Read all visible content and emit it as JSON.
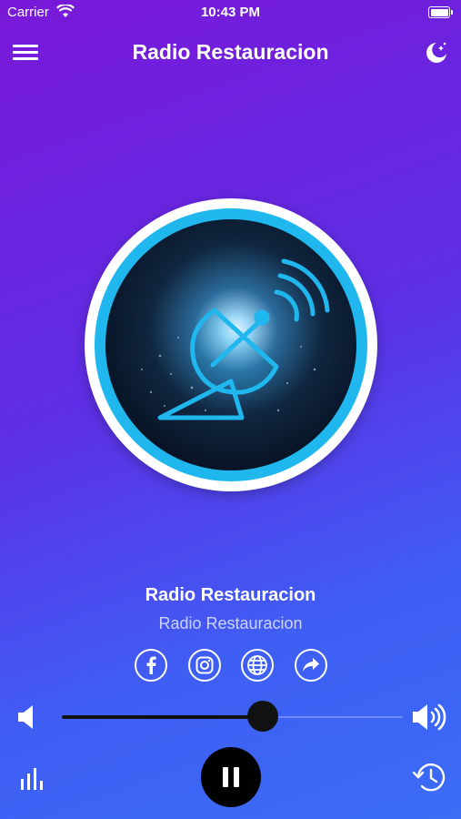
{
  "status_bar": {
    "carrier": "Carrier",
    "time": "10:43 PM"
  },
  "nav": {
    "title": "Radio Restauracion",
    "menu_icon": "hamburger-menu-icon",
    "night_icon": "moon-stars-icon"
  },
  "player": {
    "station_name": "Radio Restauracion",
    "station_subtitle": "Radio Restauracion",
    "artwork_icon": "satellite-dish-icon",
    "volume_level": 0.59,
    "state": "playing"
  },
  "social": [
    {
      "name": "facebook",
      "icon": "facebook-icon"
    },
    {
      "name": "instagram",
      "icon": "instagram-icon"
    },
    {
      "name": "website",
      "icon": "globe-icon"
    },
    {
      "name": "share",
      "icon": "share-icon"
    }
  ],
  "colors": {
    "gradient_top": "#7a18d8",
    "gradient_bottom": "#3a6cf6",
    "artwork_ring": "#1fb7ee",
    "control_dark": "#111111"
  }
}
